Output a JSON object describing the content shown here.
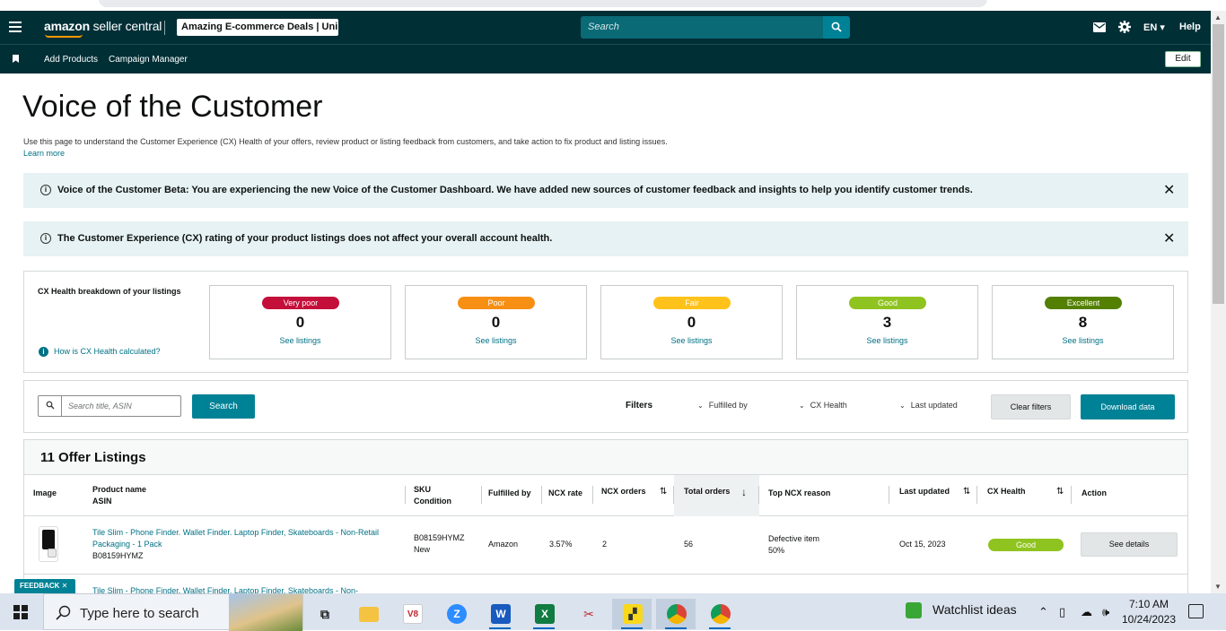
{
  "header": {
    "brand_bold": "amazon",
    "brand_rest": " seller central",
    "store": "Amazing E-commerce Deals | Uni...",
    "search_placeholder": "Search",
    "lang": "EN ▾",
    "help": "Help"
  },
  "subnav": {
    "items": [
      "Add Products",
      "Campaign Manager"
    ],
    "edit": "Edit"
  },
  "page": {
    "title": "Voice of the Customer",
    "description": "Use this page to understand the Customer Experience (CX) Health of your offers, review product or listing feedback from customers, and take action to fix product and listing issues.",
    "learn_more": "Learn more"
  },
  "alerts": [
    {
      "text": "Voice of the Customer Beta: You are experiencing the new Voice of the Customer Dashboard. We have added new sources of customer feedback and insights to help you identify customer trends."
    },
    {
      "text": "The Customer Experience (CX) rating of your product listings does not affect your overall account health."
    }
  ],
  "cx_health": {
    "title": "CX Health breakdown of your listings",
    "how_link": "How is CX Health calculated?",
    "cards": [
      {
        "label": "Very poor",
        "count": "0",
        "link": "See listings",
        "color": "#c40f3a"
      },
      {
        "label": "Poor",
        "count": "0",
        "link": "See listings",
        "color": "#f78f14"
      },
      {
        "label": "Fair",
        "count": "0",
        "link": "See listings",
        "color": "#ffc21a"
      },
      {
        "label": "Good",
        "count": "3",
        "link": "See listings",
        "color": "#8fc31f"
      },
      {
        "label": "Excellent",
        "count": "8",
        "link": "See listings",
        "color": "#538000"
      }
    ]
  },
  "filters": {
    "search_placeholder": "Search title, ASIN",
    "search_button": "Search",
    "label": "Filters",
    "dropdowns": [
      "Fulfilled by",
      "CX Health",
      "Last updated"
    ],
    "clear": "Clear filters",
    "download": "Download data"
  },
  "table": {
    "title": "11 Offer Listings",
    "columns": {
      "image": "Image",
      "product": "Product name",
      "asin": "ASIN",
      "sku": "SKU",
      "condition": "Condition",
      "fulfilled": "Fulfilled by",
      "ncx_rate": "NCX rate",
      "ncx_orders": "NCX orders",
      "total_orders": "Total orders",
      "top_reason": "Top NCX reason",
      "last_updated": "Last updated",
      "cx_health": "CX Health",
      "action": "Action"
    },
    "rows": [
      {
        "name": "Tile Slim - Phone Finder. Wallet Finder. Laptop Finder, Skateboards - Non-Retail Packaging - 1 Pack",
        "asin": "B08159HYMZ",
        "sku": "B08159HYMZ",
        "condition": "New",
        "fulfilled": "Amazon",
        "ncx_rate": "3.57%",
        "ncx_orders": "2",
        "total_orders": "56",
        "reason": "Defective item",
        "reason_pct": "50%",
        "updated": "Oct 15, 2023",
        "health": "Good",
        "action": "See details"
      },
      {
        "name": "Tile Slim - Phone Finder. Wallet Finder. Laptop Finder, Skateboards - Non-"
      }
    ]
  },
  "feedback": "FEEDBACK ✕",
  "taskbar": {
    "search": "Type here to search",
    "watchlist": "Watchlist ideas",
    "time": "7:10 AM",
    "date": "10/24/2023"
  }
}
